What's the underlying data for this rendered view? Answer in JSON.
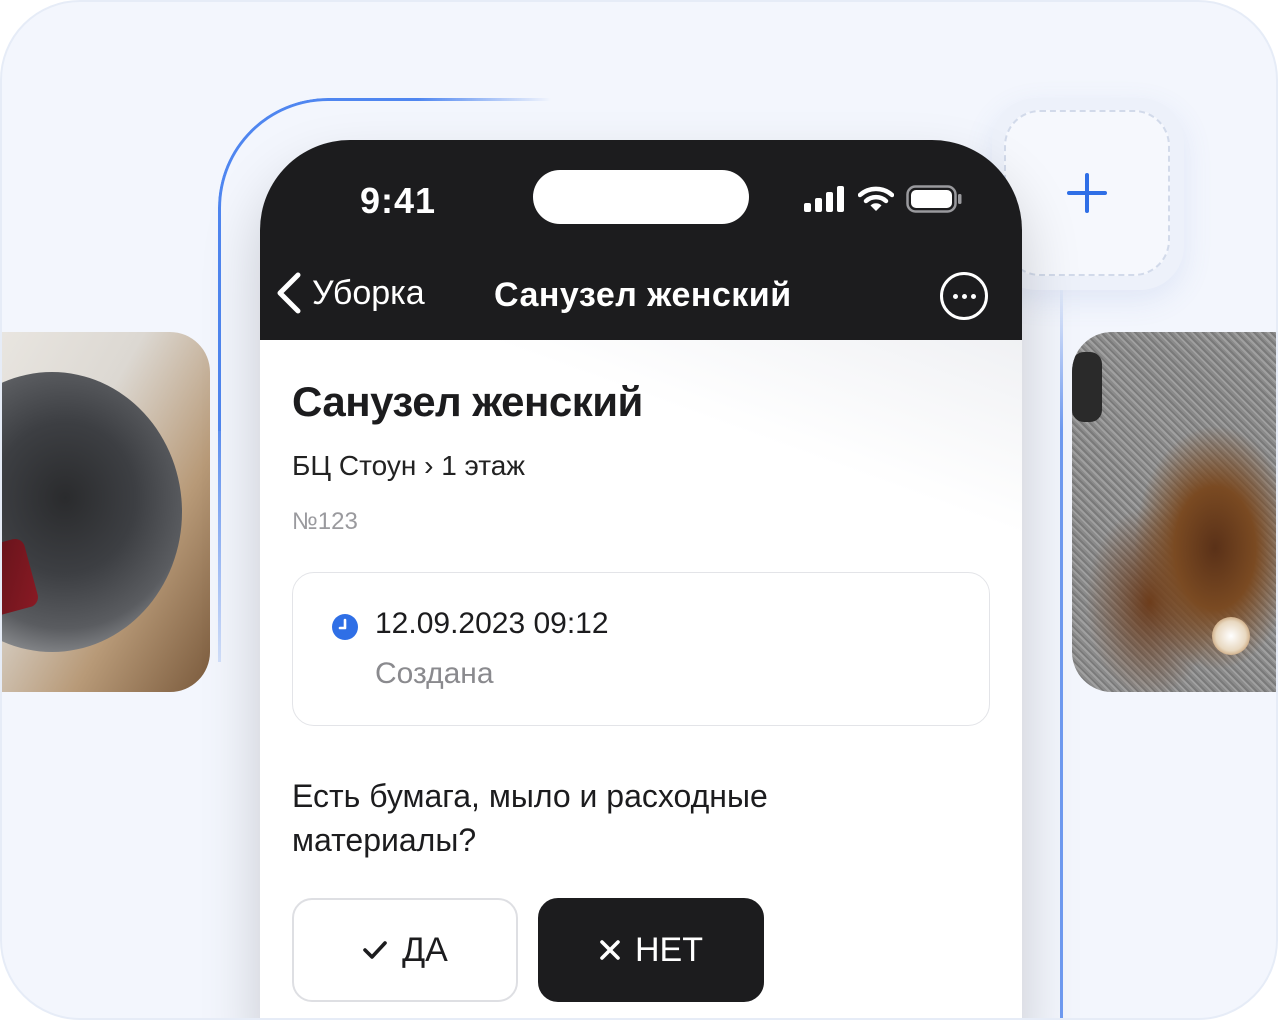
{
  "status_bar": {
    "time": "9:41"
  },
  "nav": {
    "back_label": "Уборка",
    "title": "Санузел женский"
  },
  "page": {
    "title": "Санузел женский",
    "breadcrumb": "БЦ Стоун › 1 этаж",
    "number": "№123"
  },
  "status_card": {
    "datetime": "12.09.2023 09:12",
    "status": "Создана"
  },
  "checklist": {
    "question": "Есть бумага, мыло и расходные материалы?",
    "yes_label": "ДА",
    "no_label": "НЕТ"
  },
  "icons": {
    "back": "chevron-left-icon",
    "more": "more-circle-icon",
    "clock": "clock-icon",
    "check": "check-icon",
    "cross": "close-icon",
    "plus": "plus-icon"
  },
  "colors": {
    "accent": "#2f6fe6",
    "dark": "#1c1c1e",
    "background": "#f3f6fd"
  }
}
